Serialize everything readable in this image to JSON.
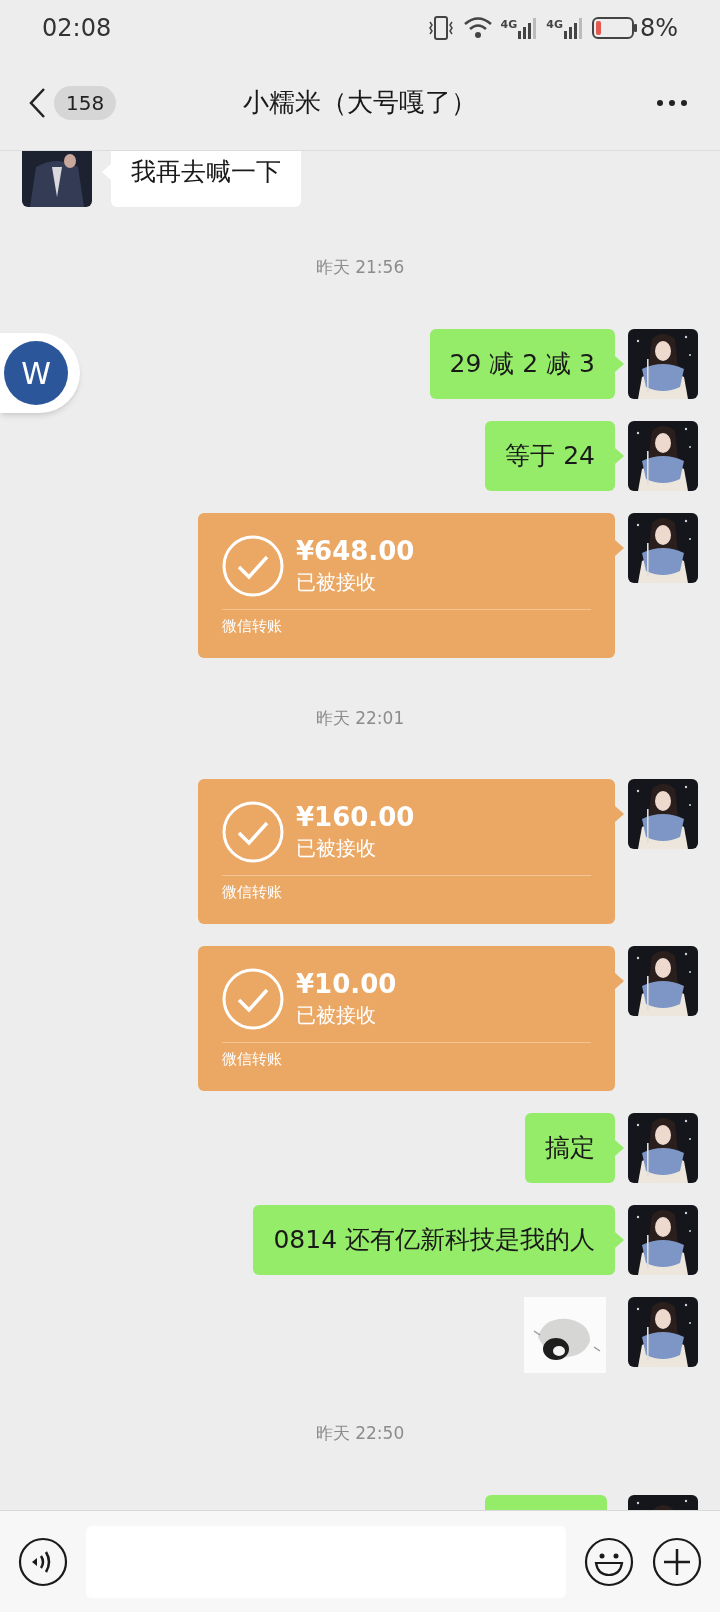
{
  "status_bar": {
    "time": "02:08",
    "network_1": "4G",
    "network_2": "4G",
    "battery": "8%"
  },
  "header": {
    "unread_count": "158",
    "title": "小糯米（大号嘎了）"
  },
  "floating_button": {
    "label": "W"
  },
  "messages": [
    {
      "kind": "text",
      "outgoing": false,
      "text": "我再去喊一下"
    },
    {
      "kind": "time",
      "text": "昨天 21:56"
    },
    {
      "kind": "text",
      "outgoing": true,
      "text": "29 减 2 减 3"
    },
    {
      "kind": "text",
      "outgoing": true,
      "text": "等于 24"
    },
    {
      "kind": "transfer",
      "outgoing": true,
      "amount": "¥648.00",
      "status": "已被接收",
      "footer": "微信转账"
    },
    {
      "kind": "time",
      "text": "昨天 22:01"
    },
    {
      "kind": "transfer",
      "outgoing": true,
      "amount": "¥160.00",
      "status": "已被接收",
      "footer": "微信转账"
    },
    {
      "kind": "transfer",
      "outgoing": true,
      "amount": "¥10.00",
      "status": "已被接收",
      "footer": "微信转账"
    },
    {
      "kind": "text",
      "outgoing": true,
      "text": "搞定"
    },
    {
      "kind": "text",
      "outgoing": true,
      "text": "0814 还有亿新科技是我的人"
    },
    {
      "kind": "sticker",
      "outgoing": true
    },
    {
      "kind": "time",
      "text": "昨天 22:50"
    },
    {
      "kind": "partial",
      "outgoing": true
    }
  ]
}
